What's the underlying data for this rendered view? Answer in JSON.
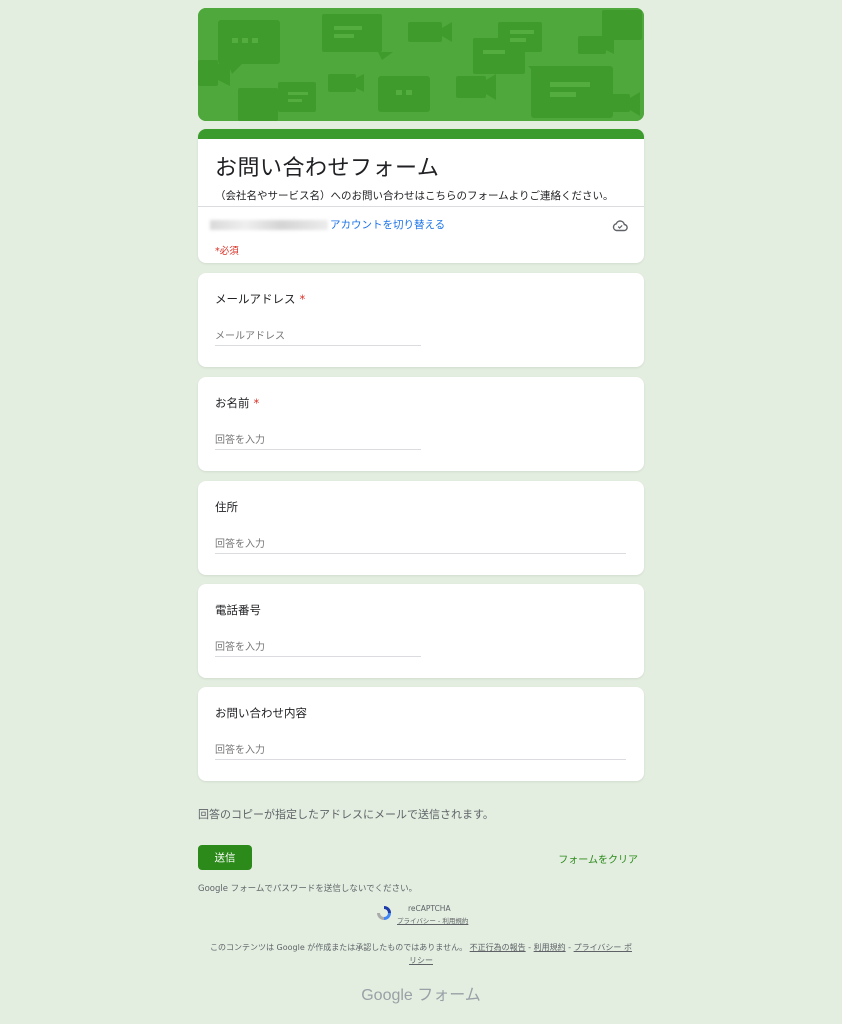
{
  "form": {
    "title": "お問い合わせフォーム",
    "description": "（会社名やサービス名）へのお問い合わせはこちらのフォームよりご連絡ください。",
    "switch_account": "アカウントを切り替える",
    "required_note": "*必須"
  },
  "questions": [
    {
      "label": "メールアドレス",
      "required_mark": "*",
      "placeholder": "メールアドレス"
    },
    {
      "label": "お名前",
      "required_mark": "*",
      "placeholder": "回答を入力"
    },
    {
      "label": "住所",
      "required_mark": "",
      "placeholder": "回答を入力"
    },
    {
      "label": "電話番号",
      "required_mark": "",
      "placeholder": "回答を入力"
    },
    {
      "label": "お問い合わせ内容",
      "required_mark": "",
      "placeholder": "回答を入力"
    }
  ],
  "copy_note": "回答のコピーが指定したアドレスにメールで送信されます。",
  "submit_label": "送信",
  "clear_label": "フォームをクリア",
  "password_note": "Google フォームでパスワードを送信しないでください。",
  "recaptcha": {
    "label": "reCAPTCHA",
    "links": "プライバシー - 利用規約"
  },
  "disclaimer": {
    "text": "このコンテンツは Google が作成または承認したものではありません。",
    "report_link": "不正行為の報告",
    "sep1": " - ",
    "terms_link": "利用規約",
    "sep2": " - ",
    "privacy_link": "プライバシー ポリシー"
  },
  "footer_logo": "Google フォーム",
  "colors": {
    "background": "#e3eee0",
    "theme": "#3b9b2c",
    "submit": "#2b8a1a",
    "required": "#d93025",
    "link": "#1a73e8"
  },
  "icons": [
    "cloud-icon",
    "recaptcha-icon"
  ]
}
